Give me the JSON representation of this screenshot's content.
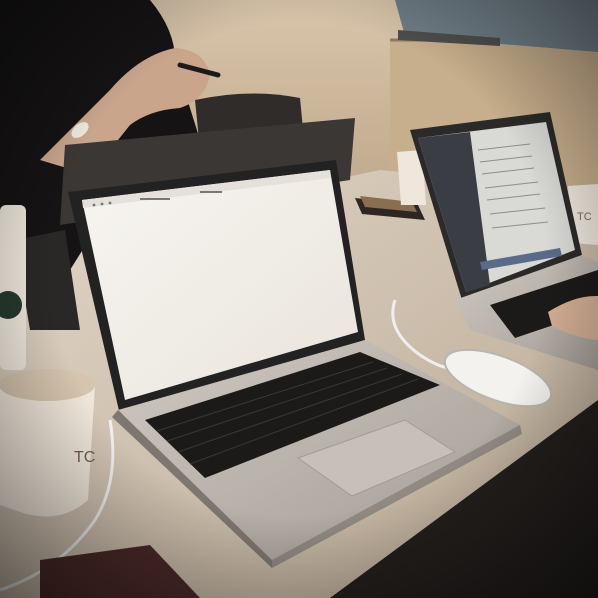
{
  "scene": {
    "description_labels": {},
    "cup_left_text": "TC",
    "cup_right_text": "TC"
  },
  "colors": {
    "wall": "#cdb79a",
    "table": "#d9ccbd",
    "laptop_silver": "#bdb6ae",
    "keyboard": "#1c1a19",
    "screen_white": "#f4f1ec",
    "shirt": "#151314",
    "skin": "#c9a58c"
  }
}
